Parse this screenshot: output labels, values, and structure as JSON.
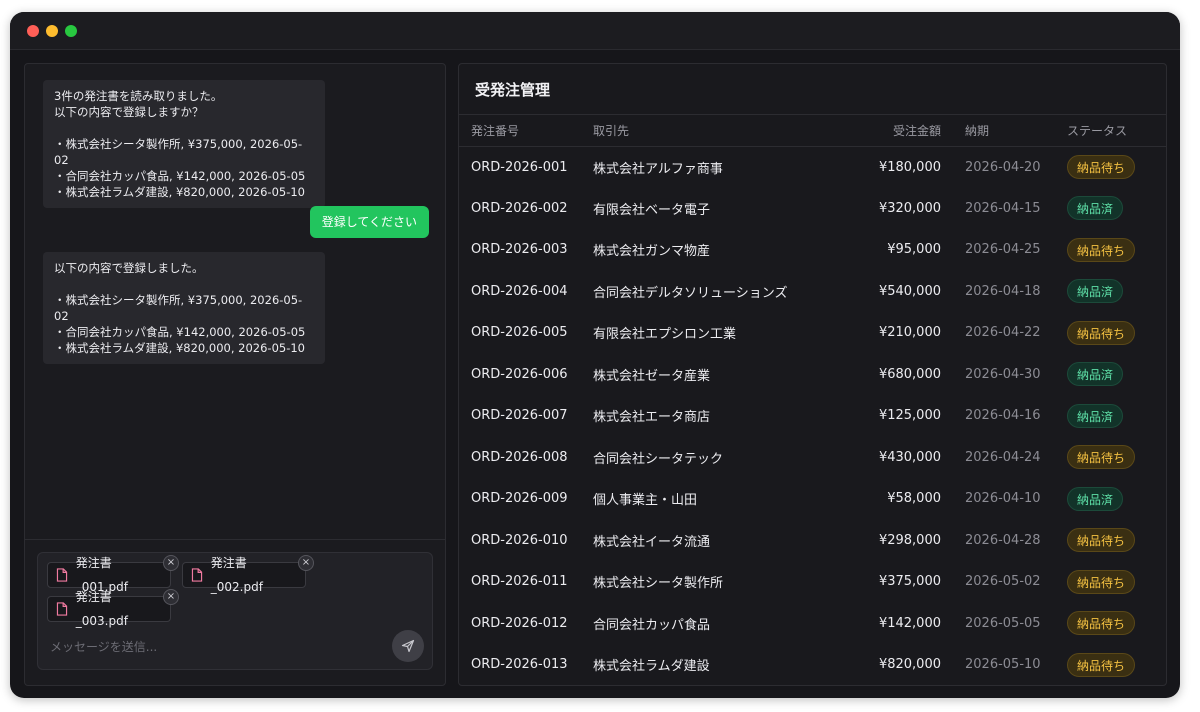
{
  "chat": {
    "messages": [
      {
        "role": "assistant",
        "text": "3件の発注書を読み取りました。\n以下の内容で登録しますか？\n\n・株式会社シータ製作所, ¥375,000, 2026-05-02\n・合同会社カッパ食品, ¥142,000, 2026-05-05\n・株式会社ラムダ建設, ¥820,000, 2026-05-10"
      },
      {
        "role": "user",
        "text": "登録してください"
      },
      {
        "role": "assistant",
        "text": "以下の内容で登録しました。\n\n・株式会社シータ製作所, ¥375,000, 2026-05-02\n・合同会社カッパ食品, ¥142,000, 2026-05-05\n・株式会社ラムダ建設, ¥820,000, 2026-05-10"
      }
    ],
    "attachments": [
      "発注書_001.pdf",
      "発注書_002.pdf",
      "発注書_003.pdf"
    ],
    "input": {
      "value": "",
      "placeholder": "メッセージを送信..."
    }
  },
  "orders": {
    "title": "受発注管理",
    "columns": [
      "発注番号",
      "取引先",
      "受注金額",
      "納期",
      "ステータス"
    ],
    "rows": [
      {
        "id": "ORD-2026-001",
        "client": "株式会社アルファ商事",
        "amount": "¥180,000",
        "date": "2026-04-20",
        "status": "納品待ち",
        "state": "pending"
      },
      {
        "id": "ORD-2026-002",
        "client": "有限会社ベータ電子",
        "amount": "¥320,000",
        "date": "2026-04-15",
        "status": "納品済",
        "state": "done"
      },
      {
        "id": "ORD-2026-003",
        "client": "株式会社ガンマ物産",
        "amount": "¥95,000",
        "date": "2026-04-25",
        "status": "納品待ち",
        "state": "pending"
      },
      {
        "id": "ORD-2026-004",
        "client": "合同会社デルタソリューションズ",
        "amount": "¥540,000",
        "date": "2026-04-18",
        "status": "納品済",
        "state": "done"
      },
      {
        "id": "ORD-2026-005",
        "client": "有限会社エプシロン工業",
        "amount": "¥210,000",
        "date": "2026-04-22",
        "status": "納品待ち",
        "state": "pending"
      },
      {
        "id": "ORD-2026-006",
        "client": "株式会社ゼータ産業",
        "amount": "¥680,000",
        "date": "2026-04-30",
        "status": "納品済",
        "state": "done"
      },
      {
        "id": "ORD-2026-007",
        "client": "株式会社エータ商店",
        "amount": "¥125,000",
        "date": "2026-04-16",
        "status": "納品済",
        "state": "done"
      },
      {
        "id": "ORD-2026-008",
        "client": "合同会社シータテック",
        "amount": "¥430,000",
        "date": "2026-04-24",
        "status": "納品待ち",
        "state": "pending"
      },
      {
        "id": "ORD-2026-009",
        "client": "個人事業主・山田",
        "amount": "¥58,000",
        "date": "2026-04-10",
        "status": "納品済",
        "state": "done"
      },
      {
        "id": "ORD-2026-010",
        "client": "株式会社イータ流通",
        "amount": "¥298,000",
        "date": "2026-04-28",
        "status": "納品待ち",
        "state": "pending"
      },
      {
        "id": "ORD-2026-011",
        "client": "株式会社シータ製作所",
        "amount": "¥375,000",
        "date": "2026-05-02",
        "status": "納品待ち",
        "state": "pending"
      },
      {
        "id": "ORD-2026-012",
        "client": "合同会社カッパ食品",
        "amount": "¥142,000",
        "date": "2026-05-05",
        "status": "納品待ち",
        "state": "pending"
      },
      {
        "id": "ORD-2026-013",
        "client": "株式会社ラムダ建設",
        "amount": "¥820,000",
        "date": "2026-05-10",
        "status": "納品待ち",
        "state": "pending"
      }
    ]
  },
  "colors": {
    "accent": "#22c55e",
    "pending": "#f5c242",
    "done": "#5ee0a8"
  },
  "icons": {
    "attachment": "pdf-file-icon",
    "remove": "close-icon",
    "send": "send-icon"
  }
}
